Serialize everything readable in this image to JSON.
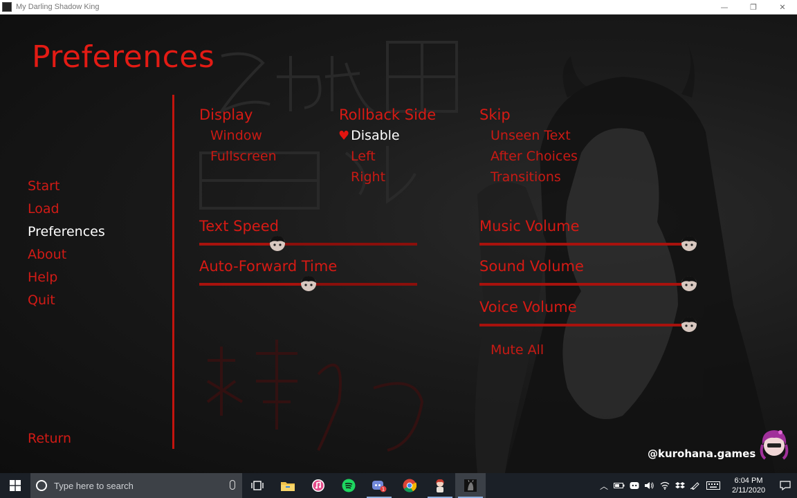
{
  "window": {
    "title": "My Darling Shadow King",
    "controls": [
      "—",
      "❐",
      "✕"
    ]
  },
  "screen": {
    "title": "Preferences",
    "nav": [
      {
        "label": "Start",
        "active": false
      },
      {
        "label": "Load",
        "active": false
      },
      {
        "label": "Preferences",
        "active": true
      },
      {
        "label": "About",
        "active": false
      },
      {
        "label": "Help",
        "active": false
      },
      {
        "label": "Quit",
        "active": false
      }
    ],
    "return_label": "Return",
    "display": {
      "heading": "Display",
      "options": [
        "Window",
        "Fullscreen"
      ]
    },
    "rollback": {
      "heading": "Rollback Side",
      "options": [
        "Disable",
        "Left",
        "Right"
      ],
      "selected": "Disable"
    },
    "skip": {
      "heading": "Skip",
      "options": [
        "Unseen Text",
        "After Choices",
        "Transitions"
      ]
    },
    "text_speed": {
      "label": "Text Speed",
      "value": 0.36
    },
    "auto_forward": {
      "label": "Auto-Forward Time",
      "value": 0.5
    },
    "music_volume": {
      "label": "Music Volume",
      "value": 1.0
    },
    "sound_volume": {
      "label": "Sound Volume",
      "value": 1.0
    },
    "voice_volume": {
      "label": "Voice Volume",
      "value": 1.0
    },
    "mute_all": "Mute All",
    "watermark": "@kurohana.games"
  },
  "colors": {
    "accent": "#d71a14",
    "active_text": "#ffffff",
    "slider_track": "#8a0f0b",
    "taskbar": "#1b2027"
  },
  "taskbar": {
    "search_placeholder": "Type here to search",
    "apps": [
      "task-view-icon",
      "file-explorer-icon",
      "itunes-icon",
      "spotify-icon",
      "discord-icon",
      "chrome-icon",
      "game-character-icon",
      "game-window-icon"
    ],
    "discord_badge": "1",
    "clock_time": "6:04 PM",
    "clock_date": "2/11/2020"
  }
}
